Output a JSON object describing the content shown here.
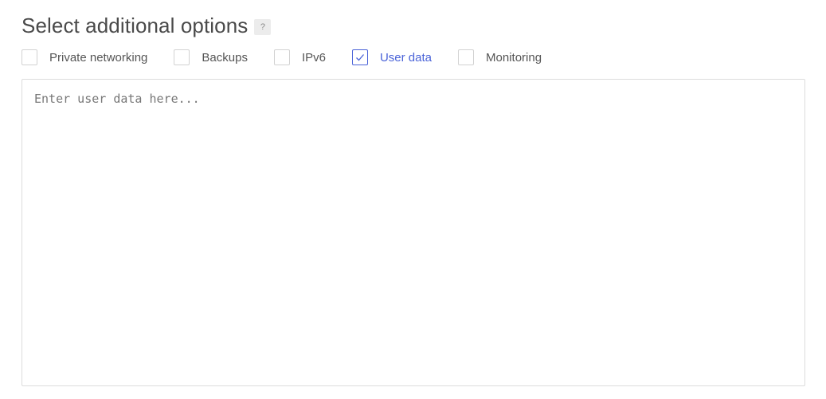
{
  "section": {
    "title": "Select additional options",
    "help_label": "?"
  },
  "options": [
    {
      "label": "Private networking",
      "checked": false
    },
    {
      "label": "Backups",
      "checked": false
    },
    {
      "label": "IPv6",
      "checked": false
    },
    {
      "label": "User data",
      "checked": true
    },
    {
      "label": "Monitoring",
      "checked": false
    }
  ],
  "user_data": {
    "value": "",
    "placeholder": "Enter user data here..."
  },
  "colors": {
    "accent": "#4a63d8",
    "text": "#555555",
    "border": "#d2d2d2"
  }
}
